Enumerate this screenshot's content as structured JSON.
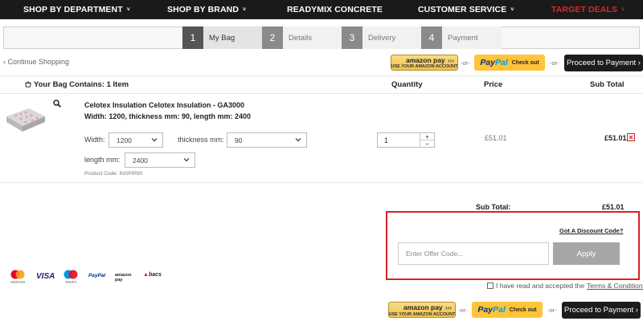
{
  "nav": {
    "items": [
      {
        "label": "SHOP BY DEPARTMENT",
        "caret": "˅"
      },
      {
        "label": "SHOP BY BRAND",
        "caret": "˅"
      },
      {
        "label": "READYMIX CONCRETE",
        "caret": ""
      },
      {
        "label": "CUSTOMER SERVICE",
        "caret": "˅"
      },
      {
        "label": "TARGET DEALS",
        "caret": "˅"
      }
    ],
    "deals_color": "#e0252b"
  },
  "steps": [
    {
      "num": "1",
      "label": "My Bag",
      "active": true
    },
    {
      "num": "2",
      "label": "Details",
      "active": false
    },
    {
      "num": "3",
      "label": "Delivery",
      "active": false
    },
    {
      "num": "4",
      "label": "Payment",
      "active": false
    }
  ],
  "checkout": {
    "continue_label": "‹ Continue Shopping",
    "or_label": "-or-",
    "amazon_label": "amazon pay",
    "amazon_arrows": "›››",
    "amazon_sub": "USE YOUR AMAZON ACCOUNT",
    "paypal_label_a": "Pay",
    "paypal_label_b": "Pal",
    "paypal_checkout": "Check out",
    "proceed_label": "Proceed to Payment ›"
  },
  "table": {
    "bag_title": "Your Bag Contains: 1 Item",
    "col_quantity": "Quantity",
    "col_price": "Price",
    "col_subtotal": "Sub Total"
  },
  "product": {
    "title_line1": "Celotex Insulation Celotex Insulation - GA3000",
    "title_line2": "Width: 1200, thickness mm: 90, length mm: 2400",
    "width_label": "Width:",
    "width_value": "1200",
    "thickness_label": "thickness mm:",
    "thickness_value": "90",
    "length_label": "length mm:",
    "length_value": "2400",
    "product_code": "Product Code: INSPIR90",
    "quantity": "1",
    "qty_plus": "+",
    "qty_minus": "−",
    "price": "£51.01",
    "subtotal": "£51.01"
  },
  "summary": {
    "subtotal_label": "Sub Total:",
    "subtotal_value": "£51.01"
  },
  "discount": {
    "got_code_label": "Got A Discount Code?",
    "placeholder": "Enter Offer Code...",
    "apply_label": "Apply",
    "border_color": "#d5222a"
  },
  "payment_logos": [
    "mastercard",
    "VISA",
    "maestro",
    "PayPal",
    "amazon pay",
    "bacs"
  ],
  "terms": {
    "text": "I have read and accepted the",
    "link": "Terms & Conditions"
  }
}
